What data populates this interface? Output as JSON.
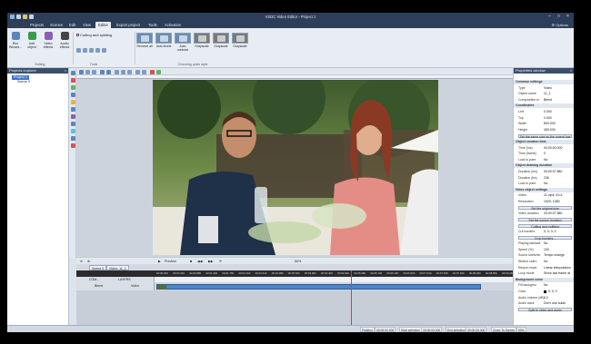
{
  "window": {
    "title": "VSDC Video Editor - Project 1",
    "options_label": "Options"
  },
  "menu": [
    "Projects",
    "Scenes",
    "Edit",
    "View",
    "Editor",
    "Export project",
    "Tools",
    "Activation"
  ],
  "menu_active_index": 4,
  "ribbon": {
    "buttons": [
      {
        "label": "Run Wizard..."
      },
      {
        "label": "Add object"
      },
      {
        "label": "Video effects"
      },
      {
        "label": "Audio effects"
      }
    ],
    "cutting_label": "Cutting and splitting",
    "groups": {
      "editing": "Editing",
      "tools": "Tools",
      "choosing": "Choosing quick style"
    },
    "styles": [
      "Remove all",
      "Auto levels",
      "Auto contrast",
      "Grayscale",
      "Grayscale",
      "Grayscale"
    ]
  },
  "left_panel": {
    "title": "Projects explorer",
    "tree": [
      "Project 1",
      "Scene 0"
    ],
    "tabs": [
      "Projects ex...",
      "Objects ex..."
    ]
  },
  "preview_bar": {
    "preview_label": "Preview",
    "zoom": "50%"
  },
  "right_panel": {
    "title": "Properties window",
    "rows": [
      {
        "type": "sec",
        "k": "Common settings"
      },
      {
        "k": "Type",
        "v": "Video"
      },
      {
        "k": "Object name",
        "v": "11_1"
      },
      {
        "k": "Composition m",
        "v": "Blend"
      },
      {
        "type": "sec",
        "k": "Coordinates"
      },
      {
        "k": "Left",
        "v": "0.000"
      },
      {
        "k": "Top",
        "v": "0.000"
      },
      {
        "k": "Width",
        "v": "800.000"
      },
      {
        "k": "Height",
        "v": "450.000"
      },
      {
        "type": "btn",
        "b": "Set the same size as the parent has"
      },
      {
        "type": "sec",
        "k": "Object creation time"
      },
      {
        "k": "Time (ms)",
        "v": "00:00:00.000"
      },
      {
        "k": "Time (frame)",
        "v": "0"
      },
      {
        "k": "Lock to pare",
        "v": "No"
      },
      {
        "type": "sec",
        "k": "Object drawing duration"
      },
      {
        "k": "Duration (ms)",
        "v": "00:00:07.880"
      },
      {
        "k": "Duration (fra)",
        "v": "236"
      },
      {
        "k": "Lock to pare",
        "v": "No"
      },
      {
        "type": "sec",
        "k": "Video object settings"
      },
      {
        "k": "Video",
        "v": "11.mp4; ID=1"
      },
      {
        "k": "Resolution",
        "v": "1920; 1080"
      },
      {
        "type": "btn",
        "b": "Set the original size"
      },
      {
        "k": "Video duration",
        "v": "00:00:07.880"
      },
      {
        "type": "btn",
        "b": "Set the source duration"
      },
      {
        "type": "btn",
        "b": "Cutting and splitting"
      },
      {
        "k": "Cut borders",
        "v": "0; 0; 0; 0"
      },
      {
        "type": "btn",
        "b": "Crop borders..."
      },
      {
        "k": "Playing backwa",
        "v": "No"
      },
      {
        "k": "Speed (%)",
        "v": "100"
      },
      {
        "k": "Sound stretchin",
        "v": "Tempo change"
      },
      {
        "k": "Stretch video",
        "v": "No"
      },
      {
        "k": "Resize mode",
        "v": "Linear interpolation"
      },
      {
        "k": "Loop mode",
        "v": "Show last frame at"
      },
      {
        "type": "sec",
        "k": "Background color"
      },
      {
        "k": "Fill backgrou",
        "v": "No"
      },
      {
        "type": "color",
        "k": "Color",
        "v": "0; 0; 0"
      },
      {
        "k": "Audio volume (dB)",
        "v": "0.0"
      },
      {
        "k": "Audio track",
        "v": "Don't use audio"
      },
      {
        "type": "btn",
        "b": "Split to video and audio"
      }
    ],
    "tabs": [
      "Properties...",
      "Resources..."
    ]
  },
  "timeline": {
    "tabs": [
      "Scene 0",
      "Video: 11_1"
    ],
    "ticks": [
      "00:00.000",
      "00:00.440",
      "00:00.880",
      "00:01.320",
      "00:01.760",
      "00:02.200",
      "00:02.640",
      "00:03.080",
      "00:03.520",
      "00:03.960",
      "00:04.400",
      "00:04.840",
      "00:05.280",
      "00:05.720",
      "00:06.160",
      "00:06.600",
      "00:07.040",
      "00:07.480",
      "00:07.920",
      "00:08.360",
      "00:08.800",
      "00:09.240"
    ],
    "row1": {
      "com": "COM...",
      "layers": "LAYERS"
    },
    "row2": {
      "mode": "Blend",
      "track": "Video"
    }
  },
  "status": {
    "position_label": "Position",
    "position": "00:00:00.000",
    "start_label": "Start selection",
    "start": "00:00:00.000",
    "end_label": "End selection",
    "end": "00:00:00.000",
    "zoom_label": "Zoom To Screen",
    "zoom": "50%"
  }
}
